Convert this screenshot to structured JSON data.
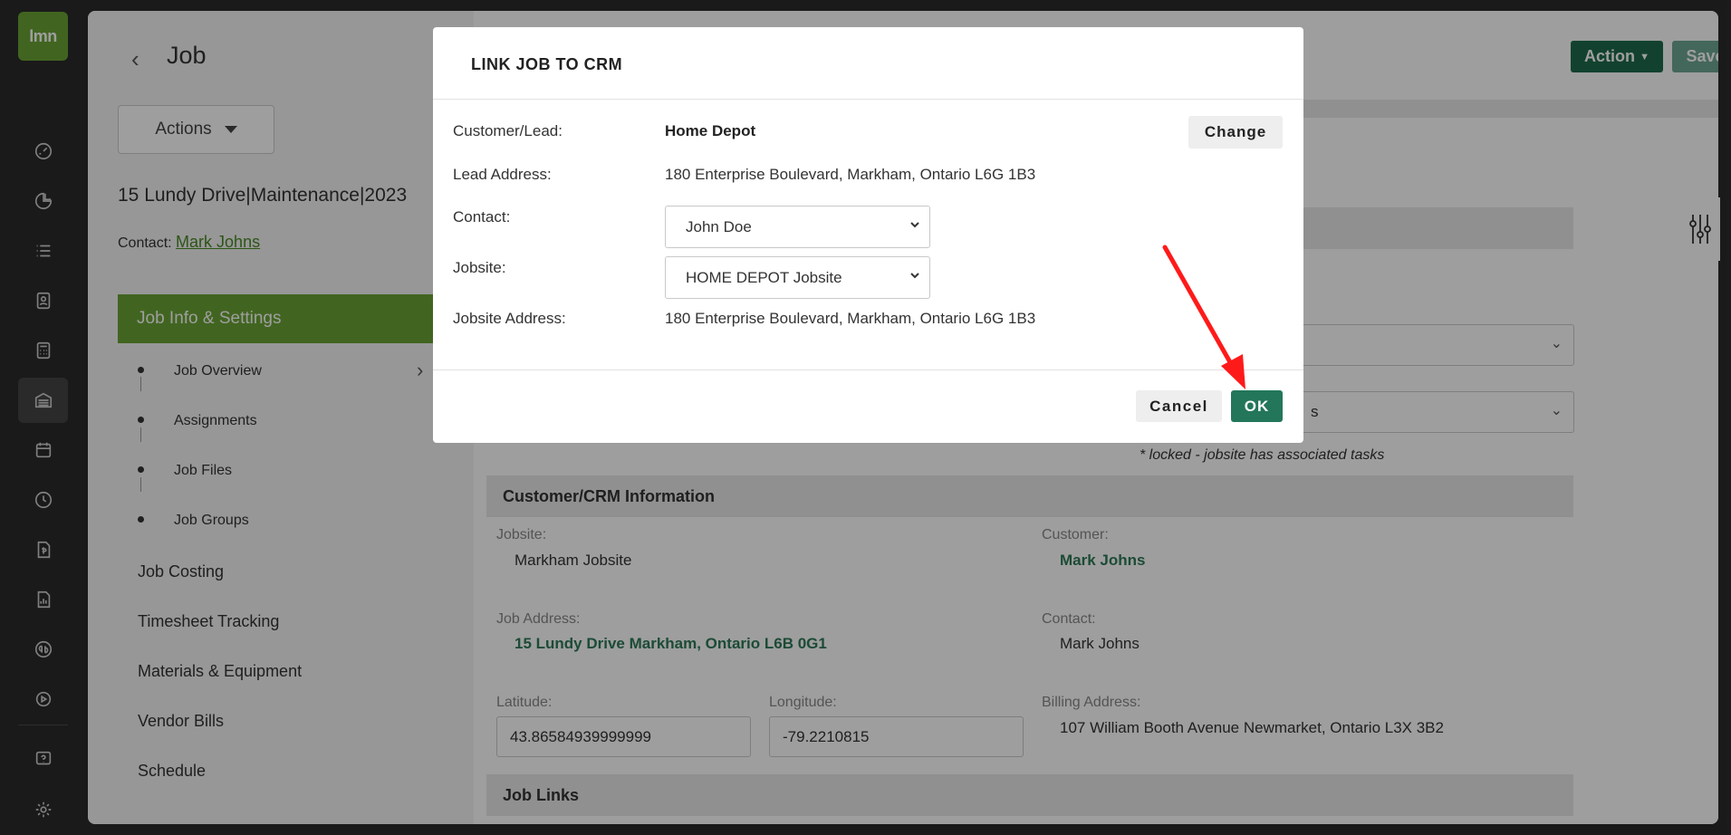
{
  "app": {
    "logo_text": "lmn",
    "rail_icons": [
      "dashboard-icon",
      "reports-icon",
      "list-icon",
      "contacts-icon",
      "calculator-icon",
      "jobs-icon",
      "calendar-icon",
      "clock-icon",
      "invoice-icon",
      "chart-doc-icon",
      "quickbooks-icon",
      "play-icon",
      "help-icon",
      "settings-icon"
    ]
  },
  "page": {
    "title": "Job",
    "actions_label": "Actions",
    "job_name": "15 Lundy Drive|Maintenance|2023",
    "contact_label": "Contact:",
    "contact_name": "Mark Johns"
  },
  "nav": {
    "active": "Job Info & Settings",
    "sub_items": [
      "Job Overview",
      "Assignments",
      "Job Files",
      "Job Groups"
    ],
    "items": [
      "Job Costing",
      "Timesheet Tracking",
      "Materials & Equipment",
      "Vendor Bills",
      "Schedule"
    ]
  },
  "toolbar": {
    "action_label": "Action",
    "save_label": "Save"
  },
  "background": {
    "locked_note": "* locked - jobsite has associated tasks",
    "select_partial": "s",
    "customer_section": "Customer/CRM Information",
    "jobsite_label": "Jobsite:",
    "jobsite_value": "Markham Jobsite",
    "customer_label": "Customer:",
    "customer_value": "Mark Johns",
    "job_address_label": "Job Address:",
    "job_address_value": "15 Lundy Drive Markham, Ontario L6B 0G1",
    "contact_label": "Contact:",
    "contact_value": "Mark Johns",
    "latitude_label": "Latitude:",
    "latitude_value": "43.86584939999999",
    "longitude_label": "Longitude:",
    "longitude_value": "-79.2210815",
    "billing_label": "Billing Address:",
    "billing_value": "107 William Booth Avenue Newmarket, Ontario L3X 3B2",
    "job_links_section": "Job Links"
  },
  "modal": {
    "title": "LINK JOB TO CRM",
    "customer_label": "Customer/Lead:",
    "customer_value": "Home Depot",
    "change_label": "Change",
    "lead_address_label": "Lead Address:",
    "lead_address_value": "180 Enterprise Boulevard, Markham, Ontario L6G 1B3",
    "contact_label": "Contact:",
    "contact_value": "John Doe",
    "jobsite_label": "Jobsite:",
    "jobsite_value": "HOME DEPOT Jobsite",
    "jobsite_address_label": "Jobsite Address:",
    "jobsite_address_value": "180 Enterprise Boulevard, Markham, Ontario L6G 1B3",
    "cancel_label": "Cancel",
    "ok_label": "OK"
  },
  "colors": {
    "brand_green": "#6aa334",
    "primary_button": "#23765a",
    "annotation_arrow": "#ff1a1a"
  }
}
